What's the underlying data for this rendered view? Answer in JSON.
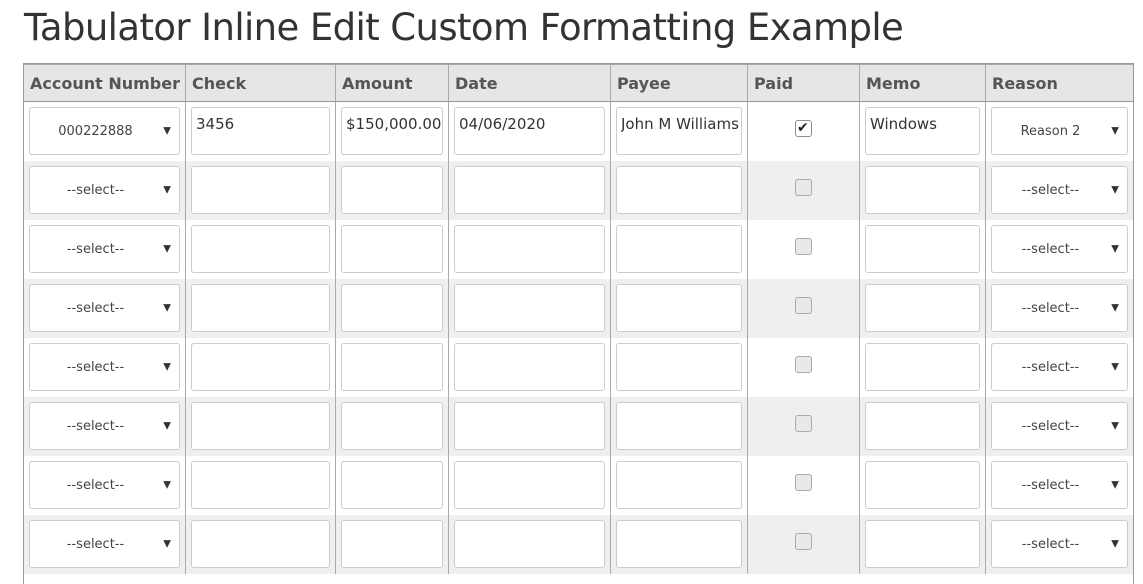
{
  "page": {
    "title": "Tabulator Inline Edit Custom Formatting Example"
  },
  "table": {
    "columns": [
      "Account Number",
      "Check",
      "Amount",
      "Date",
      "Payee",
      "Paid",
      "Memo",
      "Reason"
    ],
    "rows": [
      {
        "account": "000222888",
        "check": "3456",
        "amount": "$150,000.00",
        "date": "04/06/2020",
        "payee": "John M Williams",
        "paid": true,
        "memo": "Windows",
        "reason": "Reason 2"
      },
      {
        "account": "--select--",
        "check": "",
        "amount": "",
        "date": "",
        "payee": "",
        "paid": false,
        "memo": "",
        "reason": "--select--"
      },
      {
        "account": "--select--",
        "check": "",
        "amount": "",
        "date": "",
        "payee": "",
        "paid": false,
        "memo": "",
        "reason": "--select--"
      },
      {
        "account": "--select--",
        "check": "",
        "amount": "",
        "date": "",
        "payee": "",
        "paid": false,
        "memo": "",
        "reason": "--select--"
      },
      {
        "account": "--select--",
        "check": "",
        "amount": "",
        "date": "",
        "payee": "",
        "paid": false,
        "memo": "",
        "reason": "--select--"
      },
      {
        "account": "--select--",
        "check": "",
        "amount": "",
        "date": "",
        "payee": "",
        "paid": false,
        "memo": "",
        "reason": "--select--"
      },
      {
        "account": "--select--",
        "check": "",
        "amount": "",
        "date": "",
        "payee": "",
        "paid": false,
        "memo": "",
        "reason": "--select--"
      },
      {
        "account": "--select--",
        "check": "",
        "amount": "",
        "date": "",
        "payee": "",
        "paid": false,
        "memo": "",
        "reason": "--select--"
      }
    ]
  },
  "icons": {
    "dropdown": "caret-down-icon",
    "paid_check": "checkmark-icon"
  }
}
